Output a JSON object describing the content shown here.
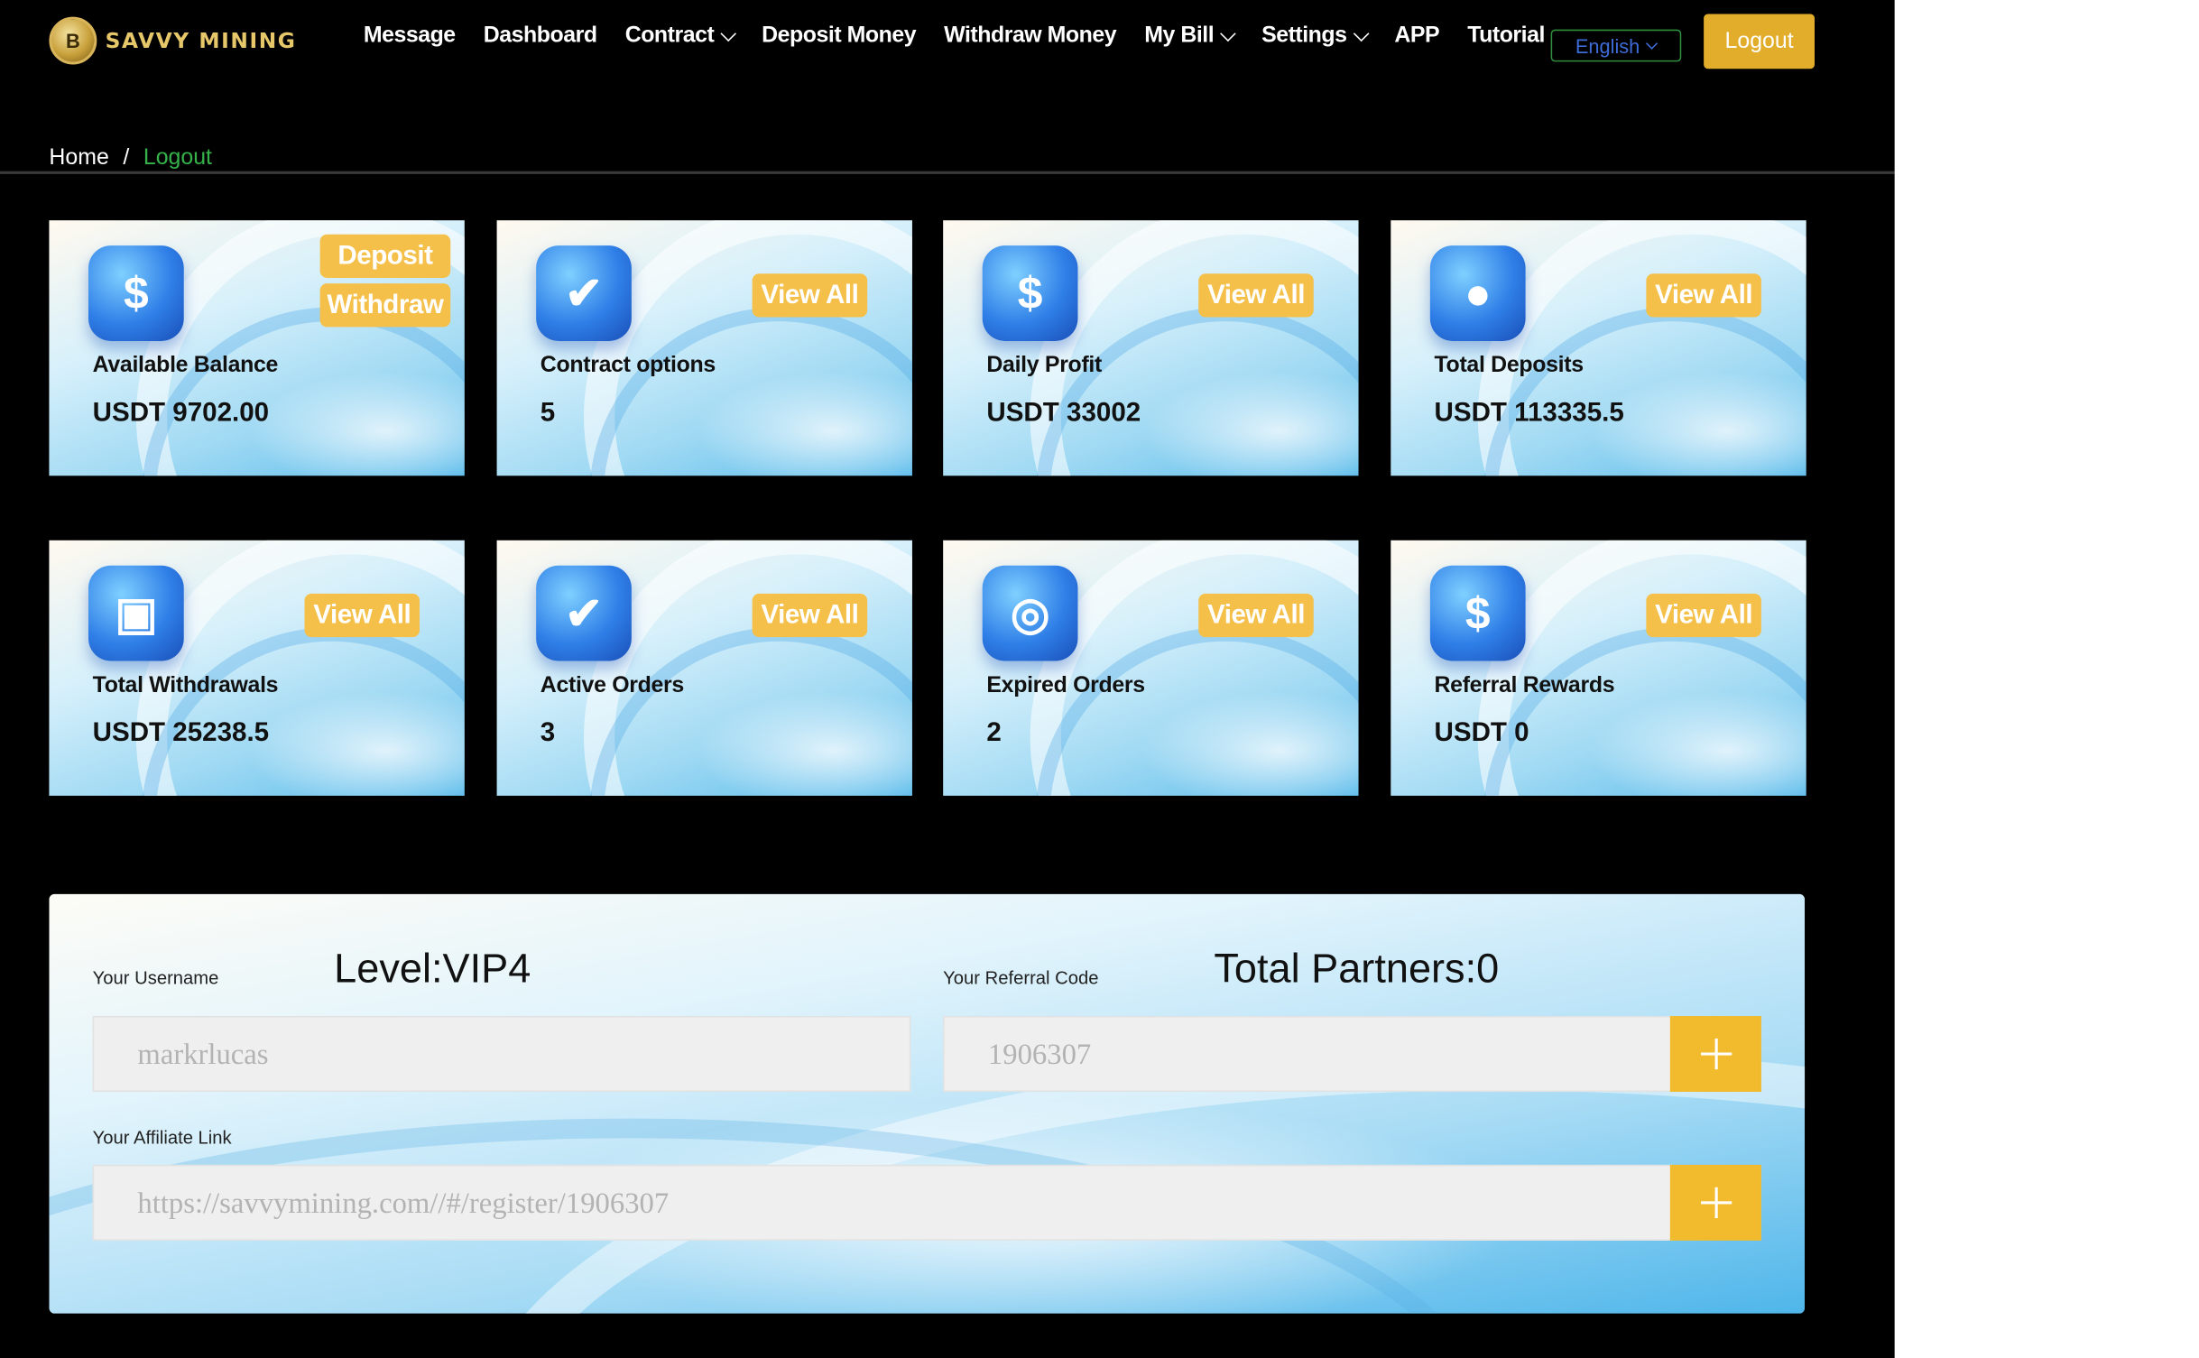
{
  "header": {
    "logo_text": "SAVVY MINING",
    "logo_badge": "B",
    "nav": [
      {
        "label": "Message",
        "dropdown": false
      },
      {
        "label": "Dashboard",
        "dropdown": false
      },
      {
        "label": "Contract",
        "dropdown": true
      },
      {
        "label": "Deposit Money",
        "dropdown": false
      },
      {
        "label": "Withdraw Money",
        "dropdown": false
      },
      {
        "label": "My Bill",
        "dropdown": true
      },
      {
        "label": "Settings",
        "dropdown": true
      },
      {
        "label": "APP",
        "dropdown": false
      },
      {
        "label": "Tutorial",
        "dropdown": false
      }
    ],
    "language": "English",
    "logout_label": "Logout"
  },
  "breadcrumb": {
    "home": "Home",
    "separator": "/",
    "current": "Logout"
  },
  "cards": [
    {
      "title": "Available Balance",
      "value": "USDT 9702.00",
      "icon": "dollar-coin-icon",
      "glyph": "$",
      "buttons": [
        "Deposit",
        "Withdraw"
      ]
    },
    {
      "title": "Contract options",
      "value": "5",
      "icon": "target-check-icon",
      "glyph": "✔",
      "buttons": [
        "View All"
      ]
    },
    {
      "title": "Daily Profit",
      "value": "USDT 33002",
      "icon": "phone-dollar-icon",
      "glyph": "$",
      "buttons": [
        "View All"
      ]
    },
    {
      "title": "Total Deposits",
      "value": "USDT 113335.5",
      "icon": "piggy-bank-icon",
      "glyph": "●",
      "buttons": [
        "View All"
      ]
    },
    {
      "title": "Total Withdrawals",
      "value": "USDT 25238.5",
      "icon": "wallet-icon",
      "glyph": "▣",
      "buttons": [
        "View All"
      ]
    },
    {
      "title": "Active Orders",
      "value": "3",
      "icon": "checklist-icon",
      "glyph": "✔",
      "buttons": [
        "View All"
      ]
    },
    {
      "title": "Expired Orders",
      "value": "2",
      "icon": "document-search-icon",
      "glyph": "◎",
      "buttons": [
        "View All"
      ]
    },
    {
      "title": "Referral Rewards",
      "value": "USDT 0",
      "icon": "trophy-coin-icon",
      "glyph": "$",
      "buttons": [
        "View All"
      ]
    }
  ],
  "referral": {
    "username_label": "Your Username",
    "level": "Level:VIP4",
    "username_value": "markrlucas",
    "referral_code_label": "Your Referral Code",
    "total_partners": "Total Partners:0",
    "referral_code_value": "1906307",
    "affiliate_label": "Your Affiliate Link",
    "affiliate_value": "https://savvymining.com//#/register/1906307"
  },
  "colors": {
    "accent": "#f5c04a",
    "logout": "#e2ad2a",
    "breadcrumb_current": "#35b34a",
    "background": "#000000"
  }
}
